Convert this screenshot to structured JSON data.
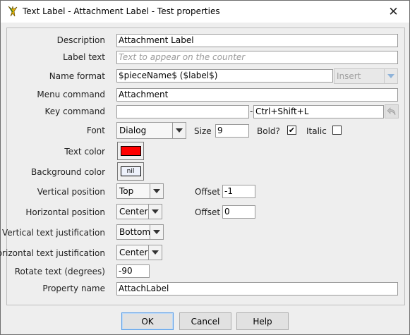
{
  "window": {
    "title": "Text Label - Attachment Label - Test properties",
    "app_icon": "vassal-icon",
    "close_glyph": "✕"
  },
  "fields": {
    "description": {
      "label": "Description",
      "value": "Attachment Label"
    },
    "label_text": {
      "label": "Label text",
      "value": "",
      "placeholder": "Text to appear on the counter"
    },
    "name_format": {
      "label": "Name format",
      "value": "$pieceName$ ($label$)",
      "insert_label": "Insert"
    },
    "menu_command": {
      "label": "Menu command",
      "value": "Attachment"
    },
    "key_command": {
      "label": "Key command",
      "value": "",
      "separator": "-",
      "keystroke": "Ctrl+Shift+L",
      "undo_icon": "undo-arrow-icon"
    },
    "font": {
      "label": "Font",
      "value": "Dialog",
      "size_label": "Size",
      "size": "9",
      "bold_label": "Bold?",
      "bold_checked": true,
      "italic_label": "Italic",
      "italic_checked": false
    },
    "text_color": {
      "label": "Text color",
      "color": "#ff0000"
    },
    "background_color": {
      "label": "Background color",
      "value": "nil"
    },
    "vertical_position": {
      "label": "Vertical position",
      "value": "Top",
      "offset_label": "Offset",
      "offset": "-1"
    },
    "horizontal_position": {
      "label": "Horizontal position",
      "value": "Center",
      "offset_label": "Offset",
      "offset": "0"
    },
    "vertical_justification": {
      "label": "Vertical text justification",
      "value": "Bottom"
    },
    "horizontal_justification": {
      "label": "Horizontal text justification",
      "value": "Center"
    },
    "rotate": {
      "label": "Rotate text (degrees)",
      "value": "-90"
    },
    "property_name": {
      "label": "Property name",
      "value": "AttachLabel"
    }
  },
  "buttons": {
    "ok": "OK",
    "cancel": "Cancel",
    "help": "Help"
  },
  "colors": {
    "window_bg": "#eeeeee",
    "default_button_border": "#5a9ee8",
    "text_color_swatch": "#ff0000"
  }
}
